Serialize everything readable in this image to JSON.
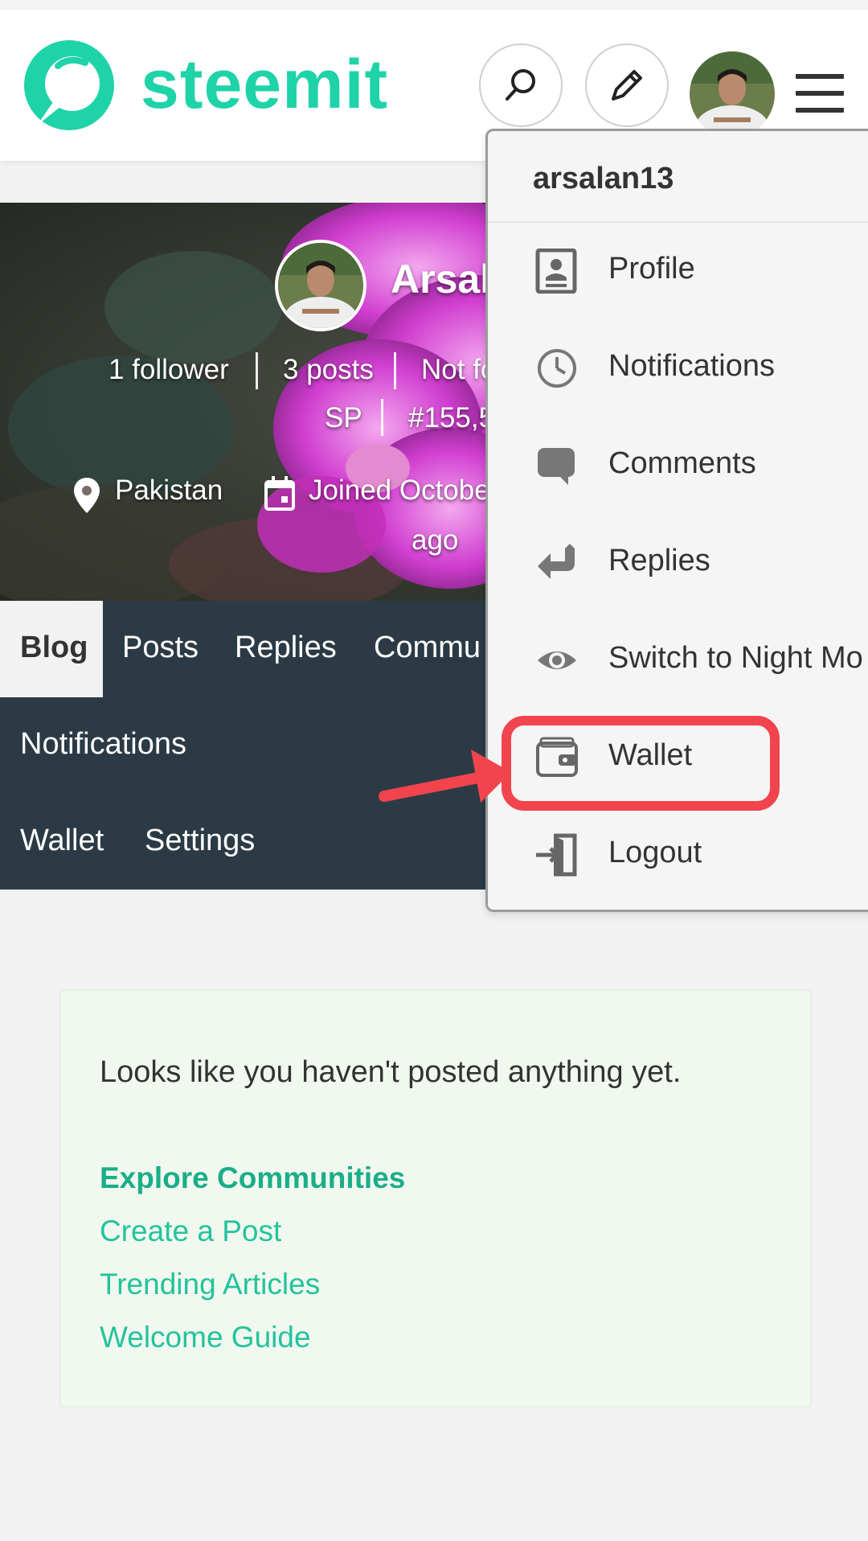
{
  "header": {
    "brand": "steemit",
    "brand_color": "#1fd3a8",
    "search_icon": "search-icon",
    "write_icon": "pencil-icon",
    "menu_icon": "hamburger-icon"
  },
  "profile": {
    "name": "Arsal",
    "followers": "1 follower",
    "posts": "3 posts",
    "following_partial": "Not fo",
    "sp_label": "SP",
    "rank_partial": "#155,5",
    "location": "Pakistan",
    "joined_partial": "Joined Octobe",
    "joined_suffix": "ago"
  },
  "tabs": {
    "row1": [
      "Blog",
      "Posts",
      "Replies",
      "Commu"
    ],
    "row2": [
      "Notifications"
    ],
    "row3": [
      "Wallet",
      "Settings"
    ],
    "active": "Blog"
  },
  "empty_state": {
    "message": "Looks like you haven't posted anything yet.",
    "links": [
      "Explore Communities",
      "Create a Post",
      "Trending Articles",
      "Welcome Guide"
    ]
  },
  "dropdown": {
    "username": "arsalan13",
    "items": [
      {
        "label": "Profile",
        "icon": "profile-card-icon"
      },
      {
        "label": "Notifications",
        "icon": "clock-icon"
      },
      {
        "label": "Comments",
        "icon": "speech-bubble-icon"
      },
      {
        "label": "Replies",
        "icon": "reply-arrow-icon"
      },
      {
        "label": "Switch to Night Mo",
        "icon": "eye-icon"
      },
      {
        "label": "Wallet",
        "icon": "wallet-icon"
      },
      {
        "label": "Logout",
        "icon": "logout-icon"
      }
    ]
  },
  "annotation": {
    "highlight_color": "#f2444d",
    "target": "Wallet"
  }
}
